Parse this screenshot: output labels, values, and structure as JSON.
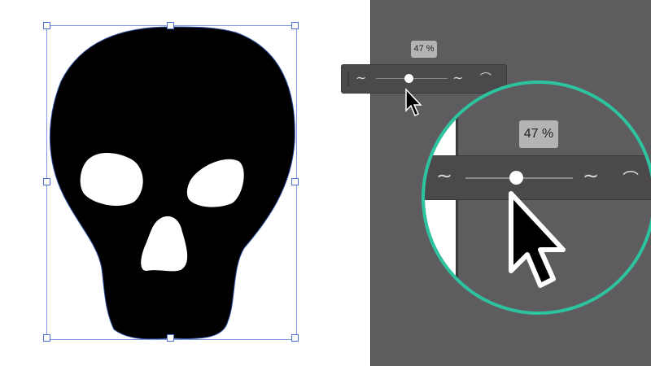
{
  "width_profile_popup": {
    "value_label": "47 %",
    "value_percent": 47,
    "icons": [
      "width-profile-left-icon",
      "width-profile-right-icon",
      "reset-profile-icon"
    ]
  },
  "magnified": {
    "value_label": "47 %"
  },
  "colors": {
    "accent_ring": "#2cc39e",
    "pasteboard": "#5e5c5e",
    "selection": "#7d97e0"
  }
}
